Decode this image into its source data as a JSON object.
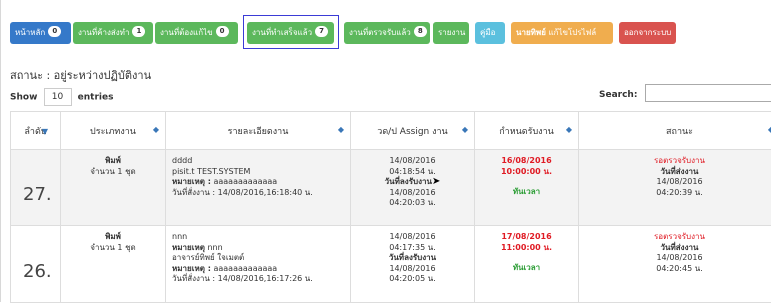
{
  "nav": {
    "home": "หน้าหลัก",
    "home_count": "0",
    "tasks": "งานที่ค้างส่งทำ",
    "tasks_count": "1",
    "revise": "งานที่ต้องแก้ไข",
    "revise_count": "0",
    "done": "งานที่ทำเสร็จแล้ว",
    "done_count": "7",
    "approved": "งานที่ตรวจรับแล้ว",
    "approved_count": "8",
    "report": "รายงาน",
    "manual": "คู่มือ",
    "profile_name": "นายทิพย์",
    "profile_edit": "แก้ไขโปรไฟล์",
    "logout": "ออกจากระบบ"
  },
  "page": {
    "status_title": "สถานะ : อยู่ระหว่างปฏิบัติงาน",
    "show_label": "Show",
    "entries_value": "10",
    "entries_label": "entries",
    "search_label": "Search:"
  },
  "table": {
    "headers": [
      "ลำดับ",
      "ประเภทงาน",
      "รายละเอียดงาน",
      "วด/ป Assign งาน",
      "กำหนดรับงาน",
      "สถานะ"
    ],
    "rows": [
      {
        "num": "27.",
        "type": "พิมพ์",
        "qty": "จำนวน 1 ชุด",
        "detail1": "dddd",
        "detail2": "pisit.t TEST.SYSTEM",
        "note_label": "หมายเหตุ :",
        "note_value": "aaaaaaaaaaaaa",
        "order_date": "วันที่สั่งงาน : 14/08/2016,16:18:40 น.",
        "assign_date": "14/08/2016",
        "assign_time": "04:18:54 น.",
        "recv_label": "วันที่ลงรับงาน",
        "recv_date": "14/08/2016",
        "recv_time": "04:20:03 น.",
        "due_date": "16/08/2016",
        "due_time": "10:00:00 น.",
        "due_status": "ทันเวลา",
        "status_text": "รอตรวจรับงาน",
        "sent_label": "วันที่ส่งงาน",
        "sent_date": "14/08/2016",
        "sent_time": "04:20:39 น."
      },
      {
        "num": "26.",
        "type": "พิมพ์",
        "qty": "จำนวน 1 ชุด",
        "detail1": "nnn",
        "note_label": "หมายเหตุ",
        "note_value": "nnn",
        "detail2": "อาจารย์ทิพย์ ใจเมตต์",
        "note2_label": "หมายเหตุ :",
        "note2_value": "aaaaaaaaaaaaa",
        "order_date": "วันที่สั่งงาน : 14/08/2016,16:17:26 น.",
        "assign_date": "14/08/2016",
        "assign_time": "04:17:35 น.",
        "recv_label": "วันที่ลงรับงาน",
        "recv_date": "14/08/2016",
        "recv_time": "04:20:05 น.",
        "due_date": "17/08/2016",
        "due_time": "11:00:00 น.",
        "due_status": "ทันเวลา",
        "status_text": "รอตรวจรับงาน",
        "sent_label": "วันที่ส่งงาน",
        "sent_date": "14/08/2016",
        "sent_time": "04:20:45 น."
      }
    ]
  }
}
